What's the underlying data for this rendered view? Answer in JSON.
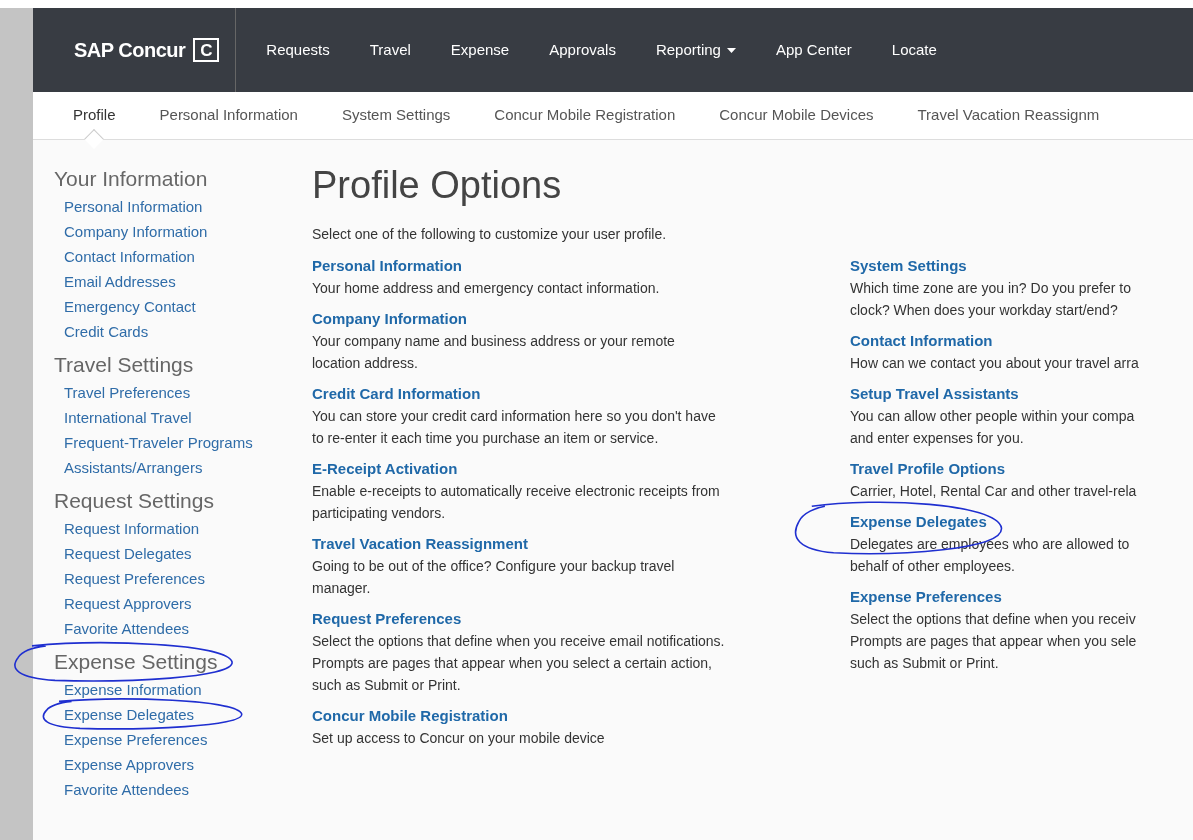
{
  "brand": {
    "name": "SAP Concur",
    "mark": "C"
  },
  "nav": [
    {
      "label": "Requests",
      "menu": false
    },
    {
      "label": "Travel",
      "menu": false
    },
    {
      "label": "Expense",
      "menu": false
    },
    {
      "label": "Approvals",
      "menu": false
    },
    {
      "label": "Reporting",
      "menu": true
    },
    {
      "label": "App Center",
      "menu": false
    },
    {
      "label": "Locate",
      "menu": false
    }
  ],
  "subnav": [
    {
      "label": "Profile",
      "selected": true
    },
    {
      "label": "Personal Information",
      "selected": false
    },
    {
      "label": "System Settings",
      "selected": false
    },
    {
      "label": "Concur Mobile Registration",
      "selected": false
    },
    {
      "label": "Concur Mobile Devices",
      "selected": false
    },
    {
      "label": "Travel Vacation Reassignm",
      "selected": false
    }
  ],
  "sidebar": [
    {
      "heading": "Your Information",
      "circled": false,
      "items": [
        {
          "label": "Personal Information",
          "circled": false
        },
        {
          "label": "Company Information",
          "circled": false
        },
        {
          "label": "Contact Information",
          "circled": false
        },
        {
          "label": "Email Addresses",
          "circled": false
        },
        {
          "label": "Emergency Contact",
          "circled": false
        },
        {
          "label": "Credit Cards",
          "circled": false
        }
      ]
    },
    {
      "heading": "Travel Settings",
      "circled": false,
      "items": [
        {
          "label": "Travel Preferences",
          "circled": false
        },
        {
          "label": "International Travel",
          "circled": false
        },
        {
          "label": "Frequent-Traveler Programs",
          "circled": false
        },
        {
          "label": "Assistants/Arrangers",
          "circled": false
        }
      ]
    },
    {
      "heading": "Request Settings",
      "circled": false,
      "items": [
        {
          "label": "Request Information",
          "circled": false
        },
        {
          "label": "Request Delegates",
          "circled": false
        },
        {
          "label": "Request Preferences",
          "circled": false
        },
        {
          "label": "Request Approvers",
          "circled": false
        },
        {
          "label": "Favorite Attendees",
          "circled": false
        }
      ]
    },
    {
      "heading": "Expense Settings",
      "circled": true,
      "items": [
        {
          "label": "Expense Information",
          "circled": false
        },
        {
          "label": "Expense Delegates",
          "circled": true
        },
        {
          "label": "Expense Preferences",
          "circled": false
        },
        {
          "label": "Expense Approvers",
          "circled": false
        },
        {
          "label": "Favorite Attendees",
          "circled": false
        }
      ]
    }
  ],
  "page": {
    "title": "Profile Options",
    "intro": "Select one of the following to customize your user profile."
  },
  "columns": [
    [
      {
        "title": "Personal Information",
        "circled": false,
        "lines": [
          "Your home address and emergency contact information."
        ]
      },
      {
        "title": "Company Information",
        "circled": false,
        "lines": [
          "Your company name and business address or your remote",
          "location address."
        ]
      },
      {
        "title": "Credit Card Information",
        "circled": false,
        "lines": [
          "You can store your credit card information here so you don't have",
          "to re-enter it each time you purchase an item or service."
        ]
      },
      {
        "title": "E-Receipt Activation",
        "circled": false,
        "lines": [
          "Enable e-receipts to automatically receive electronic receipts from",
          "participating vendors."
        ]
      },
      {
        "title": "Travel Vacation Reassignment",
        "circled": false,
        "lines": [
          "Going to be out of the office? Configure your backup travel",
          "manager."
        ]
      },
      {
        "title": "Request Preferences",
        "circled": false,
        "lines": [
          "Select the options that define when you receive email notifications.",
          "Prompts are pages that appear when you select a certain action,",
          "such as Submit or Print."
        ]
      },
      {
        "title": "Concur Mobile Registration",
        "circled": false,
        "lines": [
          "Set up access to Concur on your mobile device"
        ]
      }
    ],
    [
      {
        "title": "System Settings",
        "circled": false,
        "lines": [
          "Which time zone are you in? Do you prefer to",
          "clock? When does your workday start/end?"
        ]
      },
      {
        "title": "Contact Information",
        "circled": false,
        "lines": [
          "How can we contact you about your travel arra"
        ]
      },
      {
        "title": "Setup Travel Assistants",
        "circled": false,
        "lines": [
          "You can allow other people within your compa",
          "and enter expenses for you."
        ]
      },
      {
        "title": "Travel Profile Options",
        "circled": false,
        "lines": [
          "Carrier, Hotel, Rental Car and other travel-rela"
        ]
      },
      {
        "title": "Expense Delegates",
        "circled": true,
        "lines": [
          "Delegates are employees who are allowed to",
          "behalf of other employees."
        ]
      },
      {
        "title": "Expense Preferences",
        "circled": false,
        "lines": [
          "Select the options that define when you receiv",
          "Prompts are pages that appear when you sele",
          "such as Submit or Print."
        ]
      }
    ]
  ]
}
